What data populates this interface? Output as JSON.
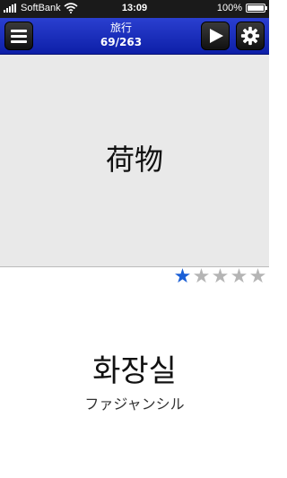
{
  "status_bar": {
    "carrier": "SoftBank",
    "time": "13:09",
    "battery": "100%"
  },
  "header": {
    "title": "旅行",
    "count": "69/263"
  },
  "card": {
    "question": "荷物",
    "answer": "화장실",
    "reading": "ファジャンシル"
  },
  "rating": {
    "value": 1,
    "max": 5
  },
  "colors": {
    "header": "#1a2fbf",
    "star_active": "#1a5fd6",
    "star_inactive": "#b5b5b5",
    "question_bg": "#e9e9e9"
  },
  "icons": [
    "menu-icon",
    "play-icon",
    "gear-icon",
    "wifi-icon",
    "battery-icon",
    "signal-icon",
    "star-icon"
  ]
}
